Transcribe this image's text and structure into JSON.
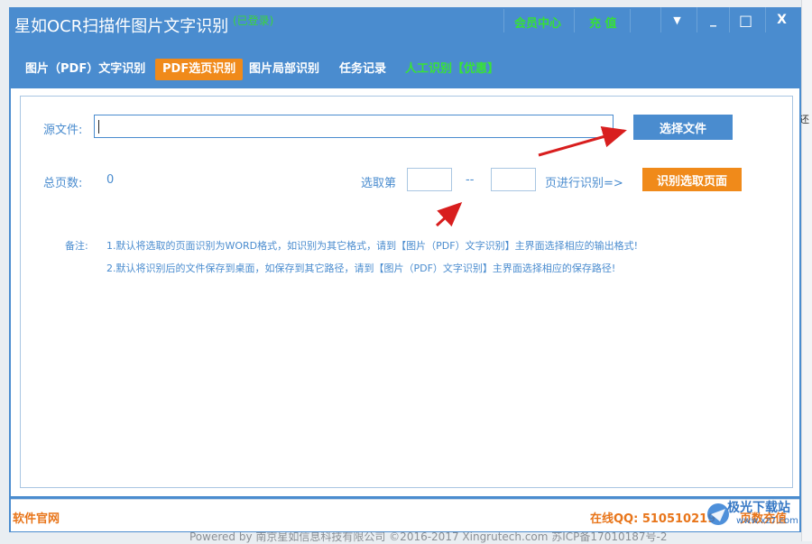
{
  "background": {
    "right_text": "还",
    "powered_by": "Powered by 南京星如信息科技有限公司 ©2016-2017 Xingrutech.com 苏ICP备17010187号-2"
  },
  "window": {
    "title": "星如OCR扫描件图片文字识别",
    "login_status": "(已登录)",
    "member_center": "会员中心",
    "recharge": "充 值",
    "buttons": {
      "dropdown": "▼",
      "minimize": "_",
      "maximize": "□",
      "close": "X"
    }
  },
  "tabs": [
    {
      "label": "图片（PDF）文字识别"
    },
    {
      "label": "PDF选页识别"
    },
    {
      "label": "图片局部识别"
    },
    {
      "label": "任务记录"
    },
    {
      "label": "人工识别【优惠】"
    }
  ],
  "form": {
    "source_label": "源文件:",
    "source_value": "",
    "choose_file": "选择文件",
    "total_pages_label": "总页数:",
    "total_pages_value": "0",
    "select_from": "选取第",
    "range_sep": "--",
    "select_to": "页进行识别=>",
    "recognize_button": "识别选取页面",
    "from_value": "",
    "to_value": ""
  },
  "notes": {
    "label": "备注:",
    "line1": "1.默认将选取的页面识别为WORD格式，如识别为其它格式，请到【图片（PDF）文字识别】主界面选择相应的输出格式!",
    "line2": "2.默认将识别后的文件保存到桌面，如保存到其它路径，请到【图片（PDF）文字识别】主界面选择相应的保存路径!"
  },
  "status": {
    "website": "软件官网",
    "qq": "在线QQ: 510510219",
    "page_recharge": "页数充值"
  },
  "watermark": {
    "text": "极光下载站",
    "url": "www.xz7.com"
  },
  "colors": {
    "window_blue": "#4a8ccf",
    "accent_orange": "#f08a1a",
    "accent_green": "#38e238",
    "arrow_red": "#d81e1e"
  }
}
